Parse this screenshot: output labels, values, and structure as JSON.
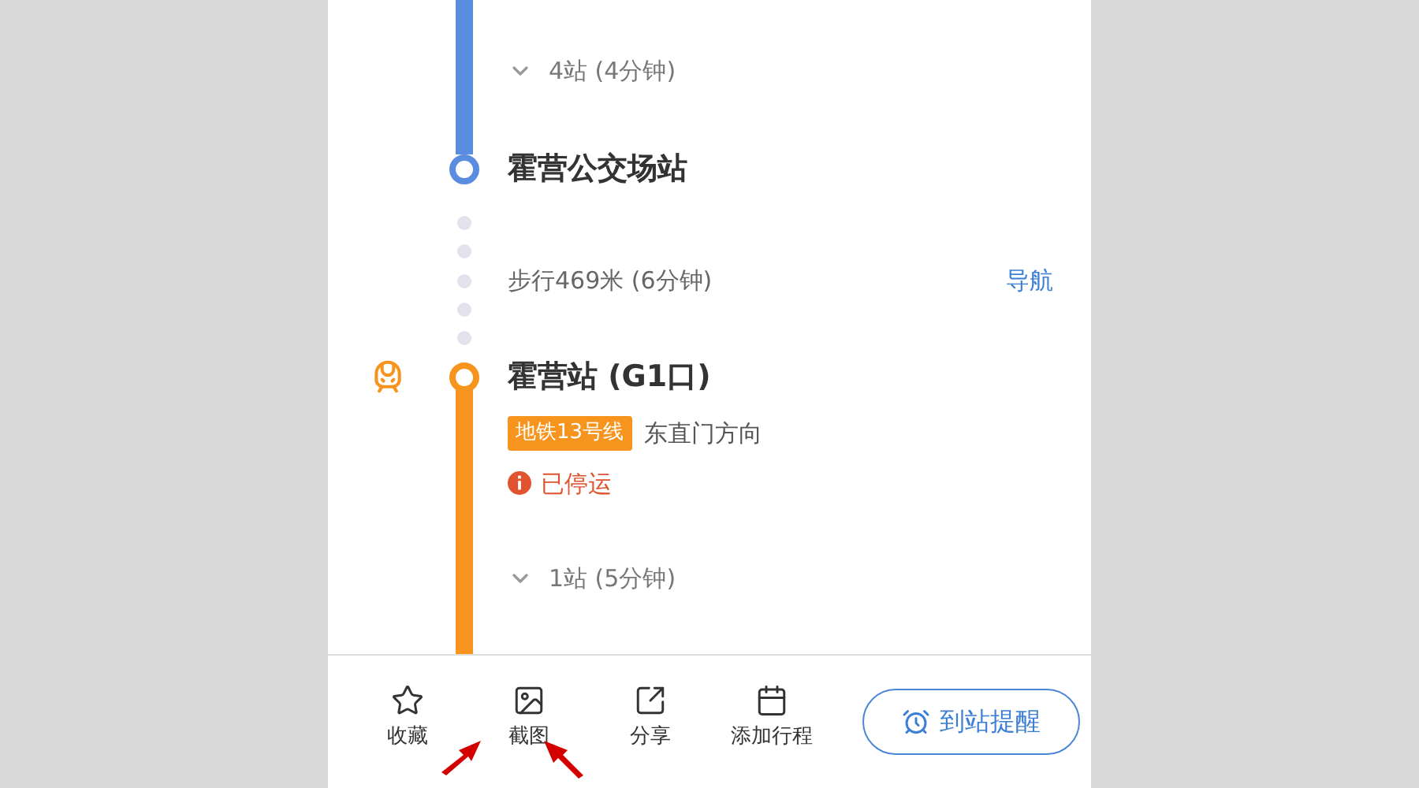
{
  "route": [
    {
      "kind": "ride",
      "color": "#5a8de0",
      "summary": "4站 (4分钟)"
    },
    {
      "kind": "station",
      "color": "#5a8de0",
      "name": "霍营公交场站"
    },
    {
      "kind": "walk",
      "text": "步行469米 (6分钟)",
      "action": "导航"
    },
    {
      "kind": "station",
      "color": "#f7941d",
      "vehicle_icon": true,
      "name": "霍营站 (G1口)",
      "line": "地铁13号线",
      "direction": "东直门方向",
      "notice": "已停运"
    },
    {
      "kind": "ride",
      "color": "#f7941d",
      "summary": "1站 (5分钟)"
    }
  ],
  "toolbar": [
    {
      "kind": "favorite",
      "label": "收藏"
    },
    {
      "kind": "screenshot",
      "label": "截图"
    },
    {
      "kind": "share",
      "label": "分享"
    },
    {
      "kind": "schedule",
      "label": "添加行程"
    }
  ],
  "alarm_button": "到站提醒"
}
